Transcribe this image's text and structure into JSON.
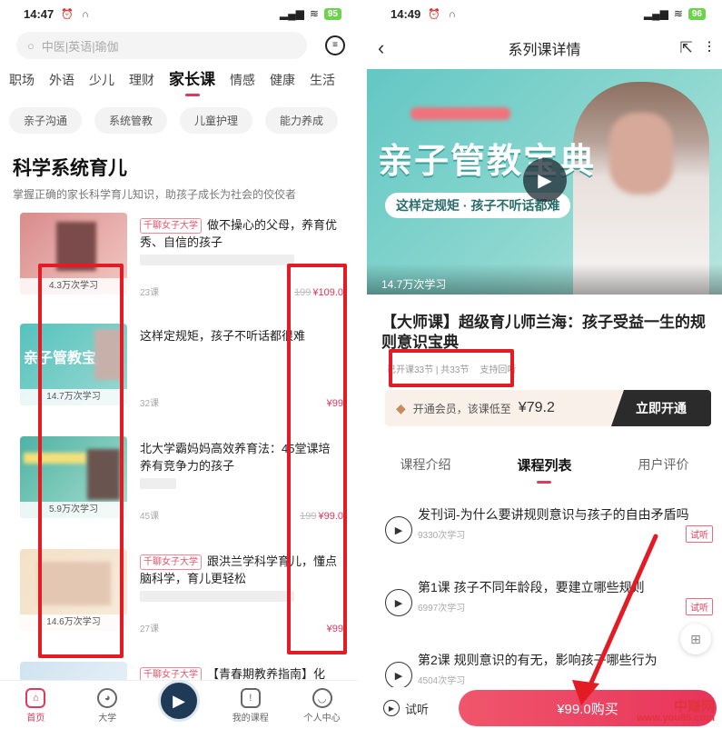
{
  "left": {
    "status": {
      "time": "14:47",
      "battery": "95"
    },
    "search": {
      "placeholder": "中医|英语|瑜伽"
    },
    "nav_tabs": [
      "职场",
      "外语",
      "少儿",
      "理财",
      "家长课",
      "情感",
      "健康",
      "生活"
    ],
    "active_tab": "家长课",
    "chips": [
      "亲子沟通",
      "系统管教",
      "儿童护理",
      "能力养成"
    ],
    "section": {
      "title": "科学系统育儿",
      "subtitle": "掌握正确的家长科学育儿知识，助孩子成长为社会的佼佼者"
    },
    "courses": [
      {
        "badge": "千聊女子大学",
        "title": "做不操心的父母，养育优秀、自信的孩子",
        "learners": "4.3万次学习",
        "lessons": "23课",
        "old_price": "199",
        "price": "¥109.0"
      },
      {
        "badge": "",
        "title": "这样定规矩，孩子不听话都很难",
        "learners": "14.7万次学习",
        "lessons": "32课",
        "old_price": "",
        "price": "¥99"
      },
      {
        "badge": "",
        "title": "北大学霸妈妈高效养育法：45堂课培养有竞争力的孩子",
        "learners": "5.9万次学习",
        "lessons": "45课",
        "old_price": "199",
        "price": "¥99.0"
      },
      {
        "badge": "千聊女子大学",
        "title": "跟洪兰学科学育儿，懂点脑科学，育儿更轻松",
        "learners": "14.6万次学习",
        "lessons": "27课",
        "old_price": "",
        "price": "¥99"
      },
      {
        "badge": "千聊女子大学",
        "title": "【青春期教养指南】化",
        "learners": "",
        "lessons": "",
        "old_price": "",
        "price": ""
      }
    ],
    "bottom_nav": [
      "首页",
      "大学",
      "",
      "我的课程",
      "个人中心"
    ]
  },
  "right": {
    "status": {
      "time": "14:49",
      "battery": "96"
    },
    "header": {
      "title": "系列课详情"
    },
    "banner": {
      "title": "亲子管教宝典",
      "slogan": "这样定规矩 · 孩子不听话都难",
      "learners": "14.7万次学习"
    },
    "course": {
      "title": "【大师课】超级育儿师兰海：孩子受益一生的规则意识宝典",
      "progress": "已开课33节 | 共33节",
      "replay": "支持回听"
    },
    "vip": {
      "text": "开通会员，该课低至",
      "price": "¥79.2",
      "button": "立即开通"
    },
    "tabs": [
      "课程介绍",
      "课程列表",
      "用户评价"
    ],
    "active_tab": "课程列表",
    "lessons": [
      {
        "title": "发刊词-为什么要讲规则意识与孩子的自由矛盾吗",
        "count": "9330次学习",
        "trial": "试听"
      },
      {
        "title": "第1课 孩子不同年龄段，要建立哪些规则",
        "count": "6997次学习",
        "trial": "试听"
      },
      {
        "title": "第2课 规则意识的有无，影响孩子哪些行为",
        "count": "4504次学习",
        "trial": ""
      }
    ],
    "bottom": {
      "try": "试听",
      "buy": "¥99.0购买"
    },
    "watermark": {
      "brand": "中赚网",
      "url": "www.you85.com"
    }
  },
  "colors": {
    "accent": "#e03a5a",
    "annotation": "#e21b24"
  }
}
